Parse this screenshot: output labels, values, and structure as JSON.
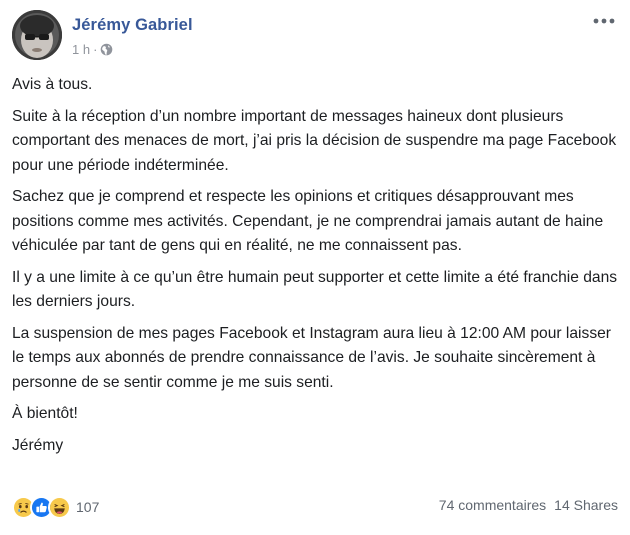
{
  "post": {
    "author": {
      "name": "Jérémy Gabriel",
      "avatar_icon": "profile-photo"
    },
    "timestamp": "1 h",
    "separator": "·",
    "audience_icon": "globe-icon",
    "menu_icon": "more-icon",
    "paragraphs": [
      "Avis à tous.",
      "Suite à la réception d’un nombre important de messages haineux dont plusieurs comportant des menaces de mort, j’ai pris la décision de suspendre ma page Facebook pour une période indéterminée.",
      "Sachez que je comprend et respecte les opinions et critiques désapprouvant mes positions comme mes activités. Cependant, je ne comprendrai jamais autant de haine véhiculée par tant de gens qui en réalité, ne me connaissent pas.",
      "Il y a une limite à ce qu’un être humain peut supporter et cette limite a été franchie dans les derniers jours.",
      "La suspension de mes pages Facebook et Instagram aura lieu à 12:00 AM pour laisser le temps aux abonnés de prendre connaissance de l’avis. Je souhaite sincèrement à personne de se sentir comme je me suis senti.",
      "À bientôt!",
      "Jérémy"
    ],
    "reactions": {
      "icons": [
        "sad-reaction-icon",
        "like-reaction-icon",
        "haha-reaction-icon"
      ],
      "count": "107"
    },
    "comments_label": "74 commentaires",
    "shares_label": "14 Shares"
  },
  "colors": {
    "author_link": "#385898",
    "text": "#1c1e21",
    "meta": "#90949c",
    "footer_text": "#606770",
    "like_blue": "#1877f2",
    "emoji_yellow": "#f7c94b"
  }
}
